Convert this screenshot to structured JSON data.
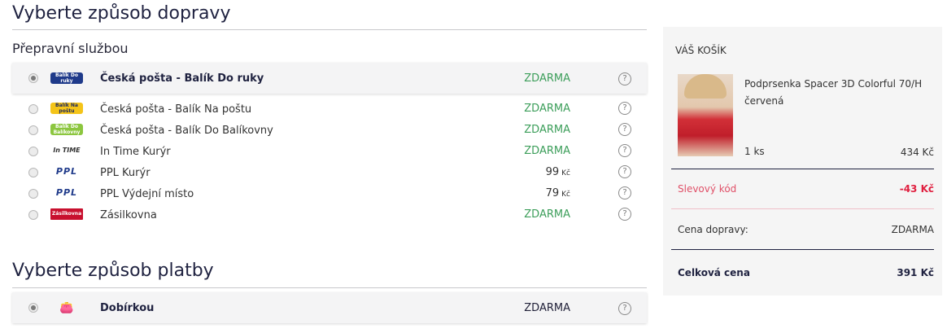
{
  "shipping": {
    "heading": "Vyberte způsob dopravy",
    "subheading": "Přepravní službou",
    "options": [
      {
        "label": "Česká pošta - Balík Do ruky",
        "price": "ZDARMA",
        "logo_text": "Balík Do ruky",
        "icon": "ceska-posta-do-ruky-logo",
        "selected": true
      },
      {
        "label": "Česká pošta - Balík Na poštu",
        "price": "ZDARMA",
        "logo_text": "Balík Na poštu",
        "icon": "ceska-posta-na-postu-logo",
        "selected": false
      },
      {
        "label": "Česká pošta - Balík Do Balíkovny",
        "price": "ZDARMA",
        "logo_text": "Balík Do Balíkovny",
        "icon": "ceska-posta-balikovna-logo",
        "selected": false
      },
      {
        "label": "In Time Kurýr",
        "price": "ZDARMA",
        "logo_text": "In TIME",
        "icon": "in-time-logo",
        "selected": false
      },
      {
        "label": "PPL Kurýr",
        "price": "99",
        "currency": "Kč",
        "logo_text": "PPL",
        "icon": "ppl-logo",
        "selected": false
      },
      {
        "label": "PPL Výdejní místo",
        "price": "79",
        "currency": "Kč",
        "logo_text": "PPL",
        "icon": "ppl-logo",
        "selected": false
      },
      {
        "label": "Zásilkovna",
        "price": "ZDARMA",
        "logo_text": "Zásilkovna",
        "icon": "zasilkovna-logo",
        "selected": false
      }
    ]
  },
  "payment": {
    "heading": "Vyberte způsob platby",
    "options": [
      {
        "label": "Dobírkou",
        "price": "ZDARMA",
        "icon": "wallet-icon",
        "selected": true
      }
    ]
  },
  "help_symbol": "?",
  "cart": {
    "title": "VÁŠ KOŠÍK",
    "item": {
      "name": "Podprsenka Spacer 3D Colorful 70/H červená",
      "quantity": "1 ks",
      "price": "434 Kč"
    },
    "discount": {
      "label": "Slevový kód",
      "value": "-43 Kč"
    },
    "shipping": {
      "label": "Cena dopravy:",
      "value": "ZDARMA"
    },
    "total": {
      "label": "Celková cena",
      "value": "391 Kč"
    }
  },
  "colors": {
    "free_price": "#3c9e5a",
    "discount": "#e02040",
    "heading": "#1f2240"
  }
}
